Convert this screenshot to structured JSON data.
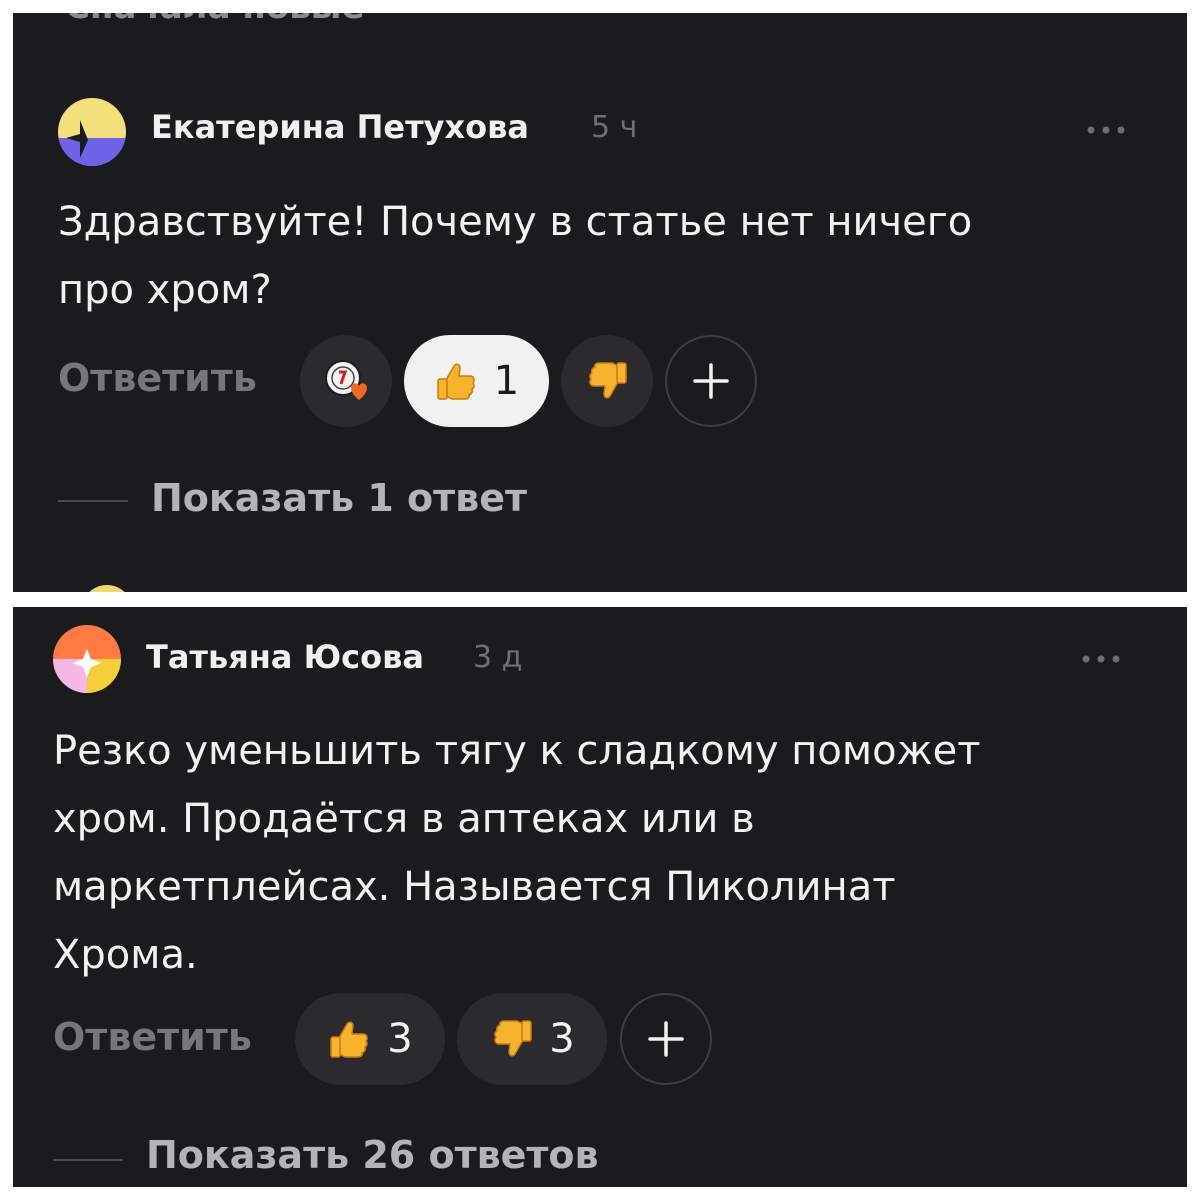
{
  "top_header": {
    "sort_label": "Сначала новые"
  },
  "comments": [
    {
      "author": "Екатерина Петухова",
      "time": "5 ч",
      "text_lines": [
        "Здравствуйте! Почему в статье нет ничего",
        "про хром?"
      ],
      "reply_label": "Ответить",
      "reactions": [
        {
          "icon": "sticker-icon",
          "count": null
        },
        {
          "icon": "thumbs-up-icon",
          "count": "1",
          "selected": true
        },
        {
          "icon": "thumbs-down-icon",
          "count": null
        }
      ],
      "show_replies": "Показать 1 ответ",
      "avatar_colors": [
        "#f4e07a",
        "#6d63e8"
      ]
    },
    {
      "author": "Татьяна Юсова",
      "time": "3 д",
      "text_lines": [
        "Резко уменьшить тягу к сладкому поможет",
        "хром. Продаётся в аптеках или в",
        "маркетплейсах. Называется Пиколинат",
        "Хрома."
      ],
      "reply_label": "Ответить",
      "reactions": [
        {
          "icon": "thumbs-up-icon",
          "count": "3"
        },
        {
          "icon": "thumbs-down-icon",
          "count": "3"
        }
      ],
      "show_replies": "Показать 26 ответов",
      "avatar_colors": [
        "#ff7a45",
        "#f7b7e6",
        "#f5cf3a"
      ]
    }
  ],
  "colors": {
    "background": "#1b1b1d",
    "chip": "#2b2b2e",
    "chip_selected": "#f1f1f1"
  }
}
